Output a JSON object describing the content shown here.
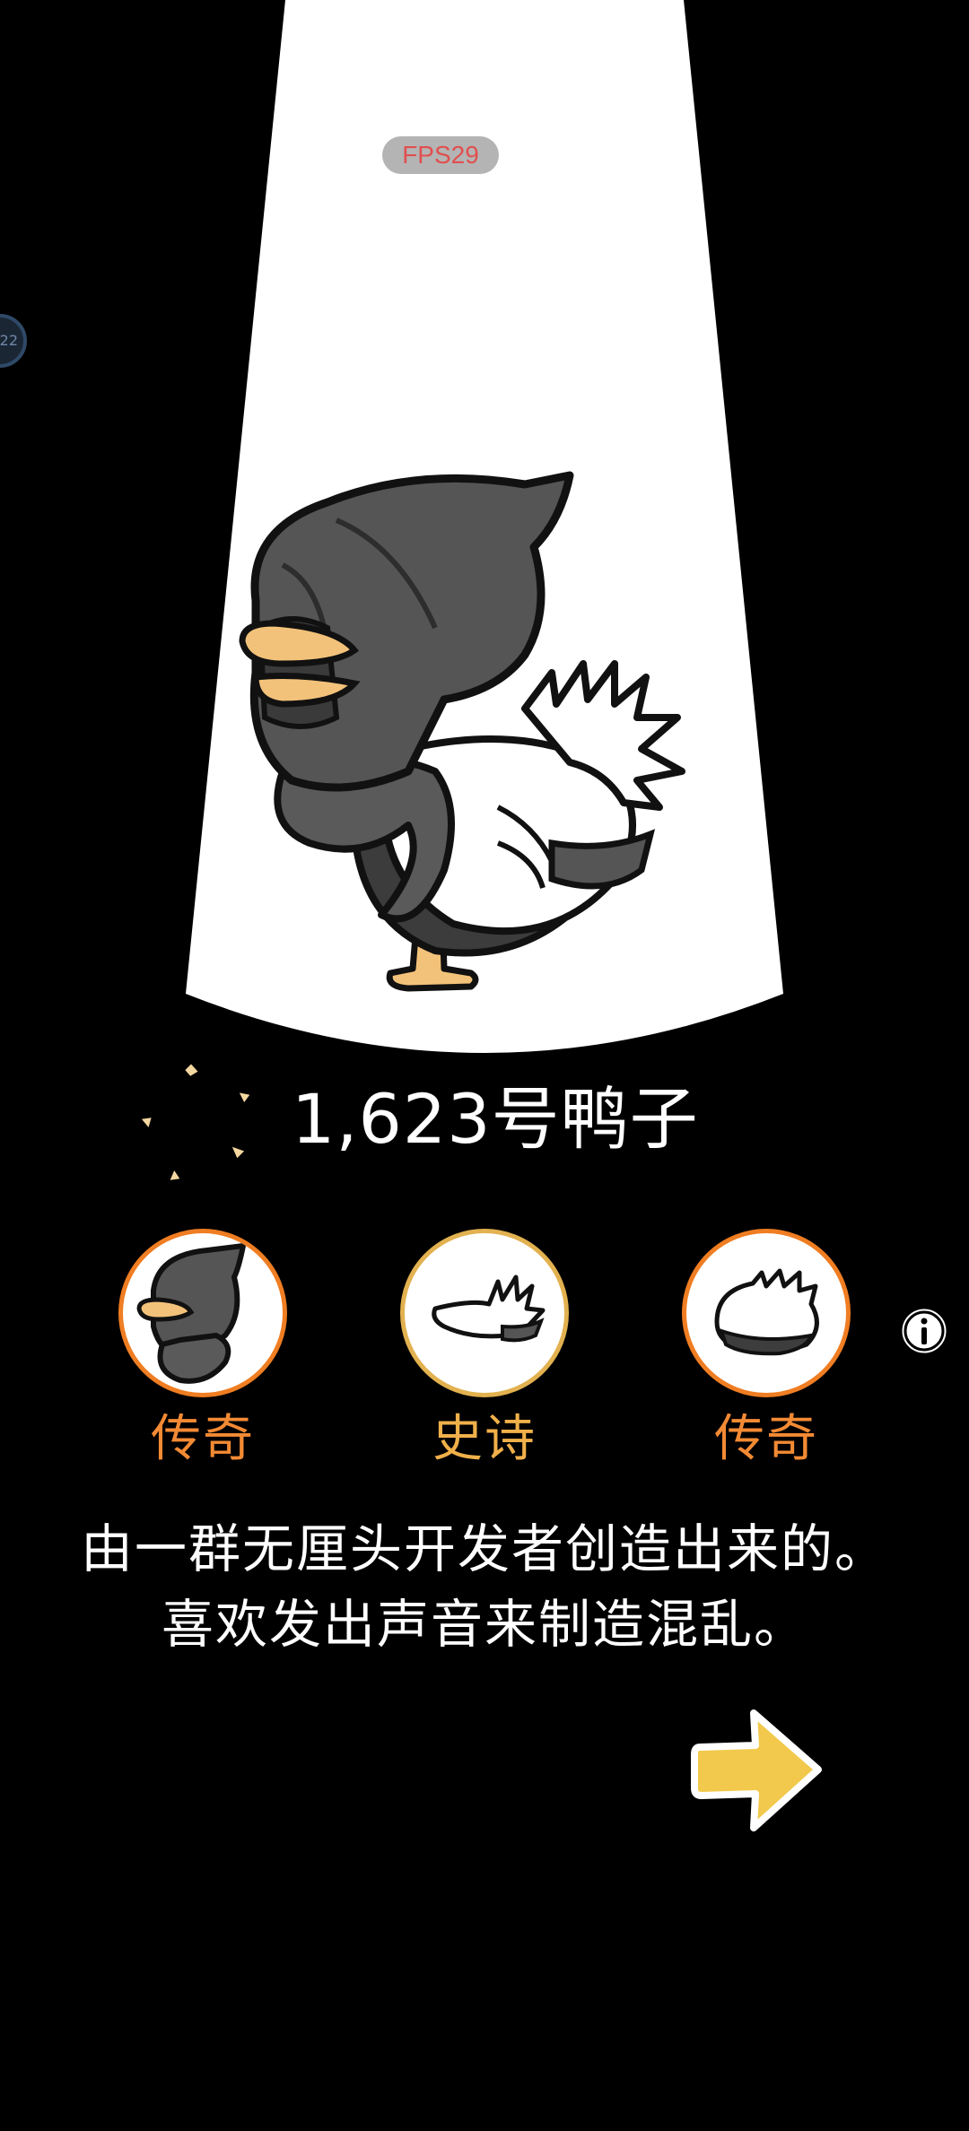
{
  "overlay": {
    "fps_label": "FPS29",
    "side_bubble_text": "22"
  },
  "duck": {
    "name": "1,623号鸭子",
    "description": "由一群无厘头开发者创造出来的。 喜欢发出声音来制造混乱。",
    "image": "hooded-black-white-duck"
  },
  "traits": [
    {
      "rarity": "传奇",
      "part": "hood-and-scarf",
      "icon": "hood-scarf-icon"
    },
    {
      "rarity": "史诗",
      "part": "wing",
      "icon": "wing-icon"
    },
    {
      "rarity": "传奇",
      "part": "tail",
      "icon": "tail-icon"
    }
  ],
  "colors": {
    "background": "#000000",
    "spotlight": "#ffffff",
    "legendary": "#f38a34",
    "epic": "#f0b04a",
    "next_arrow": "#f2c94c",
    "fps_text": "#e14f4f"
  },
  "controls": {
    "info_icon": "info-icon",
    "next_icon": "arrow-right-icon"
  }
}
